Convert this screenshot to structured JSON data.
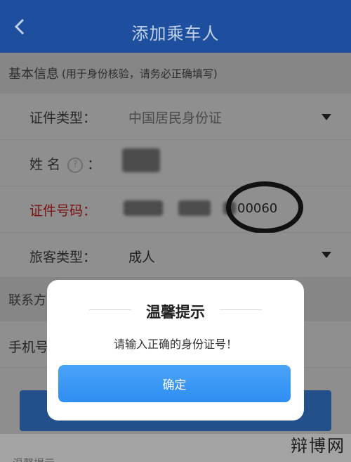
{
  "header": {
    "title": "添加乘车人",
    "back_icon": "back-chevron-icon"
  },
  "basic_section": {
    "title": "基本信息",
    "note": "(用于身份核验，请务必正确填写)"
  },
  "fields": {
    "id_type": {
      "label": "证件类型：",
      "value": "中国居民身份证"
    },
    "name": {
      "label": "姓 名",
      "help": "?",
      "colon": "："
    },
    "id_number": {
      "label": "证件号码：",
      "visible_digits": "00060"
    },
    "passenger_type": {
      "label": "旅客类型：",
      "value": "成人"
    }
  },
  "contact_section": {
    "title": "联系方"
  },
  "phone": {
    "label": "手机号"
  },
  "bottom": {
    "text": "温馨提示"
  },
  "dialog": {
    "title": "温馨提示",
    "message": "请输入正确的身份证号！",
    "confirm_label": "确定"
  },
  "watermark": "辩博网",
  "colors": {
    "header": "#1d4f9e",
    "confirm_button": "#3a98f5",
    "error_label": "#7a0f12"
  }
}
